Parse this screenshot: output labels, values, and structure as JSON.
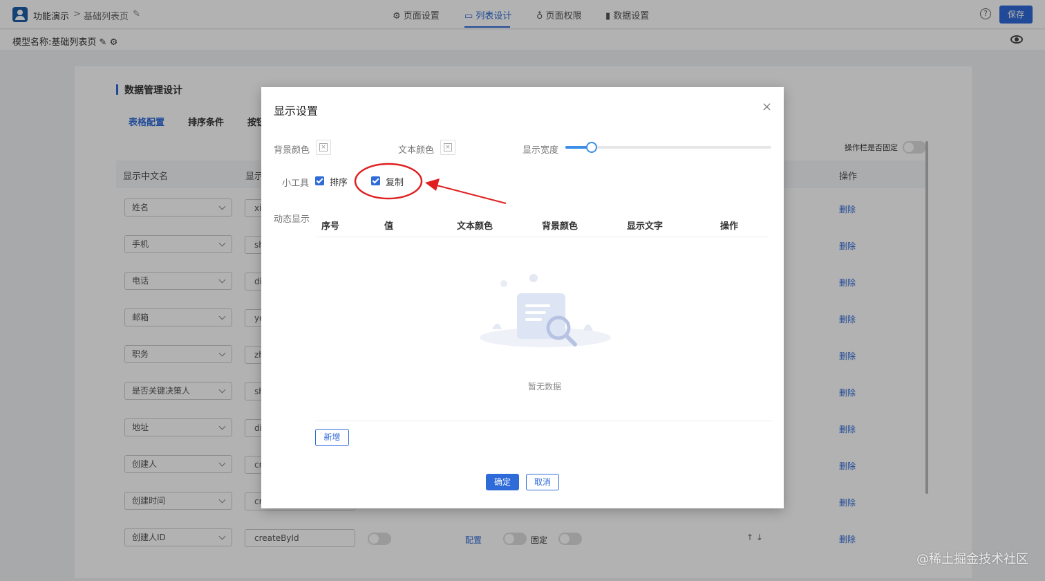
{
  "header": {
    "app_name": "功能演示",
    "breadcrumb_sep": ">",
    "page_name": "基础列表页",
    "tabs": [
      {
        "label": "页面设置"
      },
      {
        "label": "列表设计"
      },
      {
        "label": "页面权限"
      },
      {
        "label": "数据设置"
      }
    ],
    "active_tab": "列表设计",
    "help_label": "?",
    "save_label": "保存"
  },
  "subbar": {
    "model_label": "模型名称:",
    "model_name": "基础列表页"
  },
  "section": {
    "title": "数据管理设计",
    "tabs": [
      "表格配置",
      "排序条件",
      "按钮"
    ],
    "op_fixed_label": "操作栏是否固定",
    "columns": [
      "显示中文名",
      "显示",
      "操作"
    ],
    "rows": [
      {
        "name": "姓名",
        "field": "xi",
        "action": "删除"
      },
      {
        "name": "手机",
        "field": "sh",
        "action": "删除"
      },
      {
        "name": "电话",
        "field": "di",
        "action": "删除"
      },
      {
        "name": "邮箱",
        "field": "yo",
        "action": "删除"
      },
      {
        "name": "职务",
        "field": "zh",
        "action": "删除"
      },
      {
        "name": "是否关键决策人",
        "field": "sh",
        "action": "删除"
      },
      {
        "name": "地址",
        "field": "di",
        "action": "删除"
      },
      {
        "name": "创建人",
        "field": "cr",
        "action": "删除"
      },
      {
        "name": "创建时间",
        "field": "cr",
        "action": "删除"
      },
      {
        "name": "创建人ID",
        "field": "createById",
        "action": "删除"
      }
    ],
    "last_row_config": "配置",
    "last_row_pin": "固定",
    "last_row_arrows": "↑ ↓"
  },
  "modal": {
    "title": "显示设置",
    "close": "×",
    "bg_color_label": "背景颜色",
    "text_color_label": "文本颜色",
    "width_label": "显示宽度",
    "width_value": 0.13,
    "tools_label": "小工具",
    "tool_sort": "排序",
    "tool_copy": "复制",
    "dynamic_label": "动态显示",
    "table_headers": [
      "序号",
      "值",
      "文本颜色",
      "背景颜色",
      "显示文字",
      "操作"
    ],
    "empty_text": "暂无数据",
    "add_label": "新增",
    "ok_label": "确定",
    "cancel_label": "取消"
  },
  "watermark": "@稀土掘金技术社区",
  "colors": {
    "accent": "#2f6bd8",
    "annotation": "#e02020"
  }
}
